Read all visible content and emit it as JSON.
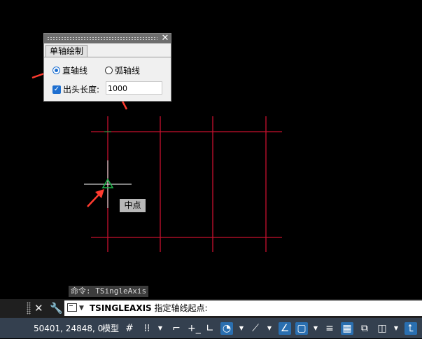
{
  "palette": {
    "tab_label": "单轴绘制",
    "close_label": "✕",
    "option_straight": "直轴线",
    "option_arc": "弧轴线",
    "overhang_label": "出头长度:",
    "overhang_value": "1000"
  },
  "snap_tooltip": "中点",
  "command_history": "命令: TSingleAxis",
  "command_line": {
    "command": "TSINGLEAXIS",
    "prompt": " 指定轴线起点:"
  },
  "status_bar": {
    "coordinates": "50401, 24848, 0",
    "model_label": "模型"
  },
  "colors": {
    "axis_line": "#c8102e",
    "cursor": "#ffffff",
    "snap_marker": "#1db44a",
    "annotation_arrow": "#ff3b2f",
    "accent": "#1e6fd0"
  }
}
